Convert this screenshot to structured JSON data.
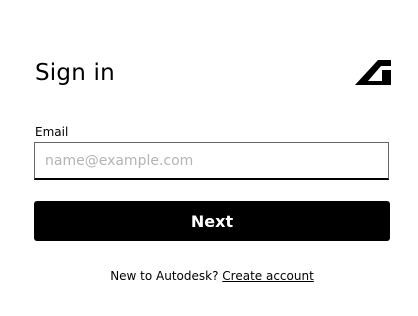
{
  "signin": {
    "title": "Sign in",
    "email_label": "Email",
    "email_value": "",
    "email_placeholder": "name@example.com",
    "next_label": "Next",
    "new_user_prompt": "New to Autodesk?",
    "create_account_label": "Create account"
  },
  "brand": {
    "logo_icon": "autodesk-logo-icon"
  },
  "colors": {
    "primary_button": "#000000",
    "button_text": "#ffffff",
    "placeholder": "#b4b4b4",
    "background": "#ffffff"
  }
}
